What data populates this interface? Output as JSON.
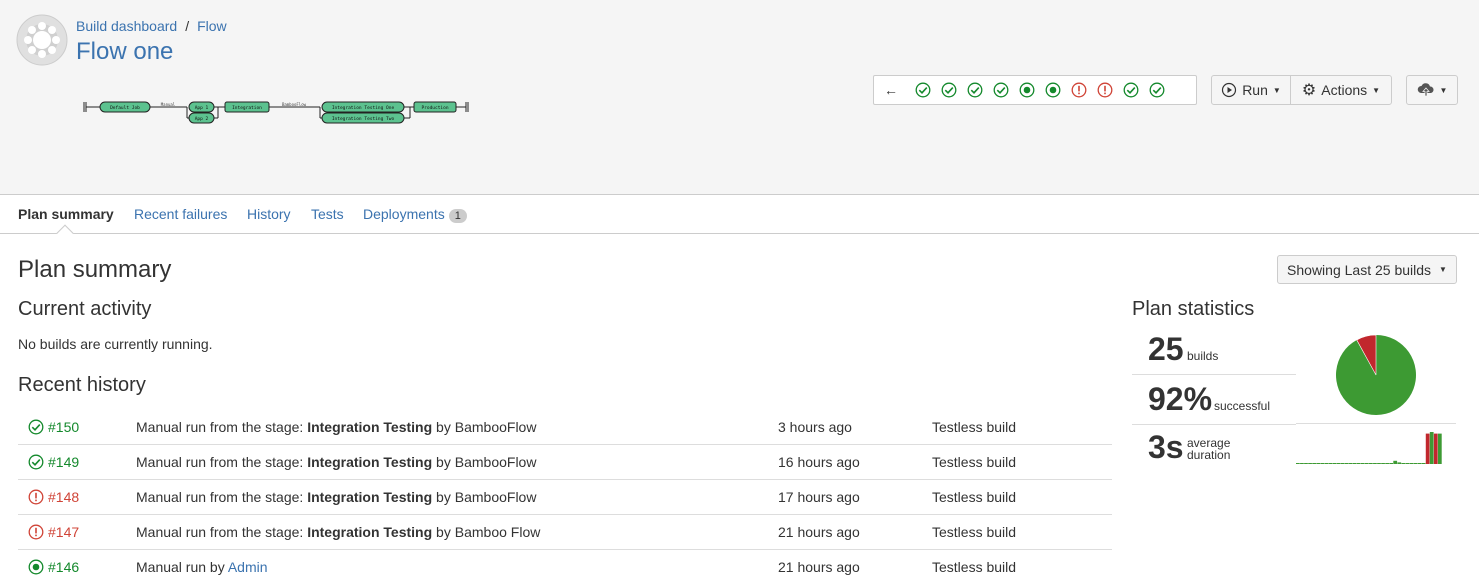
{
  "breadcrumb": {
    "root": "Build dashboard",
    "separator": "/",
    "parent": "Flow"
  },
  "plan_title": "Flow one",
  "flow_diagram": {
    "stages": [
      "Default Job",
      "App 1",
      "App 2",
      "Integration",
      "Integration Testing One",
      "Integration Testing Two",
      "Production"
    ],
    "connectors": [
      "Manual",
      "BambooFlow"
    ]
  },
  "build_strip": {
    "back_arrow": "←",
    "statuses": [
      "success",
      "success",
      "success",
      "success",
      "in-progress",
      "in-progress",
      "failed",
      "failed",
      "success",
      "success"
    ]
  },
  "toolbar": {
    "run_label": "Run",
    "actions_label": "Actions"
  },
  "tabs": [
    {
      "label": "Plan summary"
    },
    {
      "label": "Recent failures"
    },
    {
      "label": "History"
    },
    {
      "label": "Tests"
    },
    {
      "label": "Deployments",
      "badge": "1"
    }
  ],
  "main": {
    "title": "Plan summary",
    "showing_label": "Showing Last 25 builds",
    "current_activity_title": "Current activity",
    "no_builds_text": "No builds are currently running.",
    "recent_history_title": "Recent history"
  },
  "history": [
    {
      "status": "success",
      "number": "#150",
      "prefix": "Manual run from the stage: ",
      "stage": "Integration Testing",
      "by": " by ",
      "user": "BambooFlow",
      "time": "3 hours ago",
      "tests": "Testless build"
    },
    {
      "status": "success",
      "number": "#149",
      "prefix": "Manual run from the stage: ",
      "stage": "Integration Testing",
      "by": " by ",
      "user": "BambooFlow",
      "time": "16 hours ago",
      "tests": "Testless build"
    },
    {
      "status": "failed",
      "number": "#148",
      "prefix": "Manual run from the stage: ",
      "stage": "Integration Testing",
      "by": " by ",
      "user": "BambooFlow",
      "time": "17 hours ago",
      "tests": "Testless build"
    },
    {
      "status": "failed",
      "number": "#147",
      "prefix": "Manual run from the stage: ",
      "stage": "Integration Testing",
      "by": " by ",
      "user": "Bamboo Flow",
      "time": "21 hours ago",
      "tests": "Testless build"
    },
    {
      "status": "in-progress",
      "number": "#146",
      "prefix": "Manual run by ",
      "stage": "",
      "by": "",
      "user": "Admin",
      "time": "21 hours ago",
      "tests": "Testless build"
    }
  ],
  "stats": {
    "title": "Plan statistics",
    "builds_value": "25",
    "builds_label": "builds",
    "success_value": "92%",
    "success_label": "successful",
    "duration_value": "3s",
    "duration_label_1": "average",
    "duration_label_2": "duration",
    "success_fraction": 0.92,
    "duration_bars": [
      0.02,
      0.02,
      0.02,
      0.02,
      0.02,
      0.02,
      0.02,
      0.02,
      0.02,
      0.02,
      0.02,
      0.02,
      0.02,
      0.02,
      0.02,
      0.02,
      0.02,
      0.02,
      0.02,
      0.02,
      0.02,
      0.02,
      0.02,
      0.02,
      0.1,
      0.05,
      0.02,
      0.02,
      0.02,
      0.02,
      0.02,
      0.02,
      0.95,
      1.0,
      0.95,
      0.95
    ]
  },
  "colors": {
    "success": "#14892c",
    "failed": "#d04437",
    "link": "#3b73af",
    "pie_success": "#3d9a33",
    "pie_failed": "#c1272d"
  }
}
